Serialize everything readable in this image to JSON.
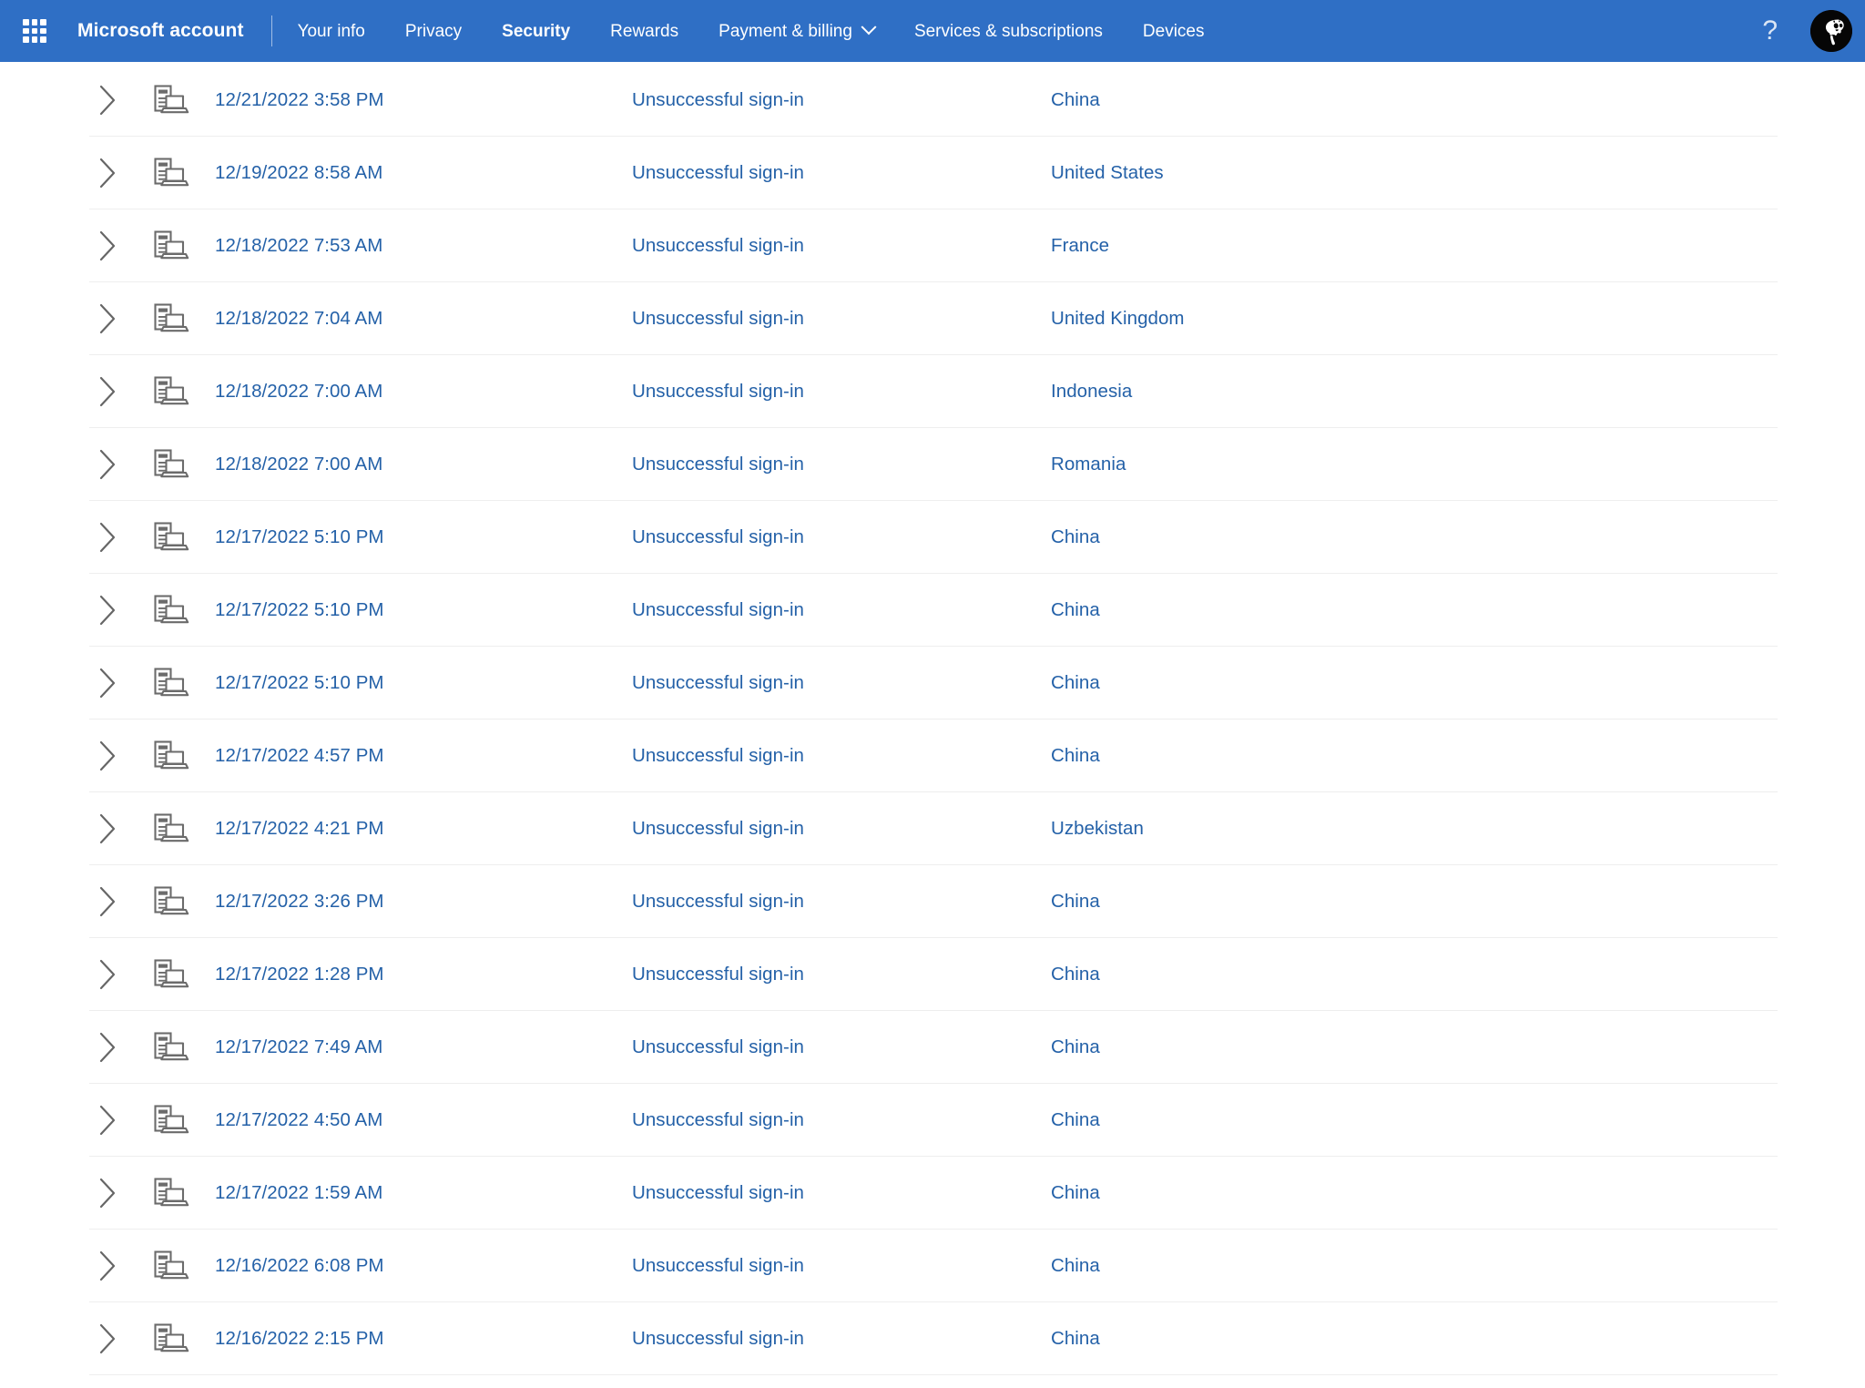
{
  "header": {
    "waffle_icon": "app-launcher-waffle-icon",
    "brand": "Microsoft account",
    "nav_items": [
      {
        "label": "Your info",
        "active": false,
        "has_caret": false
      },
      {
        "label": "Privacy",
        "active": false,
        "has_caret": false
      },
      {
        "label": "Security",
        "active": true,
        "has_caret": false
      },
      {
        "label": "Rewards",
        "active": false,
        "has_caret": false
      },
      {
        "label": "Payment & billing",
        "active": false,
        "has_caret": true
      },
      {
        "label": "Services & subscriptions",
        "active": false,
        "has_caret": false
      },
      {
        "label": "Devices",
        "active": false,
        "has_caret": false
      }
    ],
    "help_icon": "?",
    "avatar_name": "user-avatar",
    "colors": {
      "nav_background": "#2f6fc5",
      "nav_text": "#ffffff",
      "link_blue": "#2461a8",
      "row_divider": "#eeeeee"
    }
  },
  "activity": {
    "expand_icon": "chevron-right-icon",
    "device_icon": "desktop-and-laptop-icon",
    "rows": [
      {
        "date": "12/21/2022 3:58 PM",
        "type": "Unsuccessful sign-in",
        "location": "China"
      },
      {
        "date": "12/19/2022 8:58 AM",
        "type": "Unsuccessful sign-in",
        "location": "United States"
      },
      {
        "date": "12/18/2022 7:53 AM",
        "type": "Unsuccessful sign-in",
        "location": "France"
      },
      {
        "date": "12/18/2022 7:04 AM",
        "type": "Unsuccessful sign-in",
        "location": "United Kingdom"
      },
      {
        "date": "12/18/2022 7:00 AM",
        "type": "Unsuccessful sign-in",
        "location": "Indonesia"
      },
      {
        "date": "12/18/2022 7:00 AM",
        "type": "Unsuccessful sign-in",
        "location": "Romania"
      },
      {
        "date": "12/17/2022 5:10 PM",
        "type": "Unsuccessful sign-in",
        "location": "China"
      },
      {
        "date": "12/17/2022 5:10 PM",
        "type": "Unsuccessful sign-in",
        "location": "China"
      },
      {
        "date": "12/17/2022 5:10 PM",
        "type": "Unsuccessful sign-in",
        "location": "China"
      },
      {
        "date": "12/17/2022 4:57 PM",
        "type": "Unsuccessful sign-in",
        "location": "China"
      },
      {
        "date": "12/17/2022 4:21 PM",
        "type": "Unsuccessful sign-in",
        "location": "Uzbekistan"
      },
      {
        "date": "12/17/2022 3:26 PM",
        "type": "Unsuccessful sign-in",
        "location": "China"
      },
      {
        "date": "12/17/2022 1:28 PM",
        "type": "Unsuccessful sign-in",
        "location": "China"
      },
      {
        "date": "12/17/2022 7:49 AM",
        "type": "Unsuccessful sign-in",
        "location": "China"
      },
      {
        "date": "12/17/2022 4:50 AM",
        "type": "Unsuccessful sign-in",
        "location": "China"
      },
      {
        "date": "12/17/2022 1:59 AM",
        "type": "Unsuccessful sign-in",
        "location": "China"
      },
      {
        "date": "12/16/2022 6:08 PM",
        "type": "Unsuccessful sign-in",
        "location": "China"
      },
      {
        "date": "12/16/2022 2:15 PM",
        "type": "Unsuccessful sign-in",
        "location": "China"
      }
    ]
  }
}
